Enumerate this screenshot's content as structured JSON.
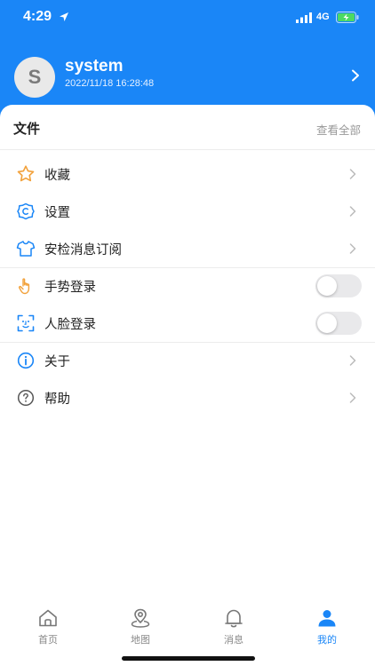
{
  "status_bar": {
    "time": "4:29",
    "network": "4G"
  },
  "profile": {
    "avatar_letter": "S",
    "username": "system",
    "last_login": "2022/11/18 16:28:48"
  },
  "files_section": {
    "title": "文件",
    "see_all": "查看全部"
  },
  "menu": {
    "favorites": "收藏",
    "settings": "设置",
    "safety_subscription": "安检消息订阅",
    "gesture_login": "手势登录",
    "face_login": "人脸登录",
    "about": "关于",
    "help": "帮助"
  },
  "toggles": {
    "gesture_login": false,
    "face_login": false
  },
  "tabbar": {
    "home": "首页",
    "map": "地图",
    "messages": "消息",
    "mine": "我的"
  },
  "colors": {
    "brand": "#1a86f7",
    "favorite_icon": "#f2a13a",
    "gesture_icon": "#f2a13a"
  }
}
